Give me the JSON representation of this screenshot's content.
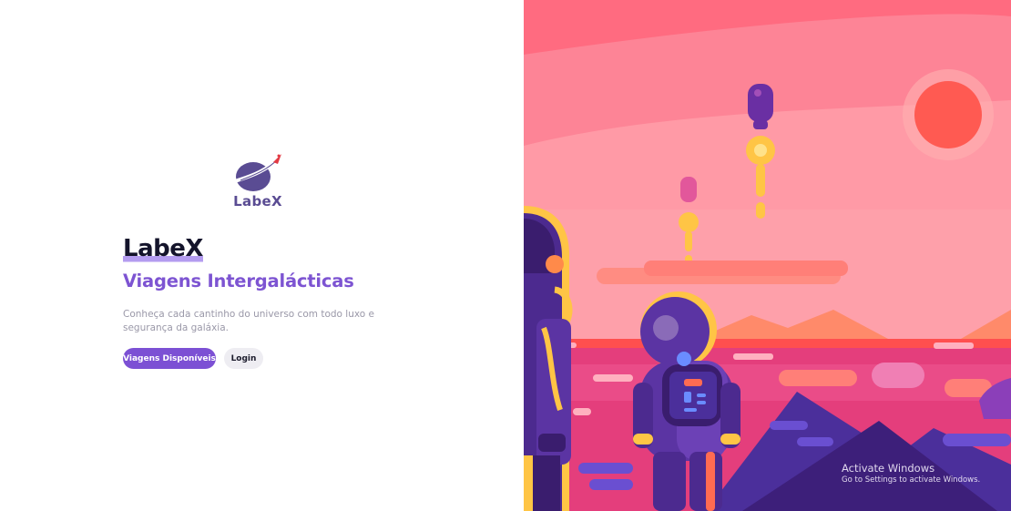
{
  "brand": {
    "logo_text": "LabeX",
    "title": "LabeX",
    "subtitle": "Viagens Intergalácticas",
    "description": "Conheça cada cantinho do universo com todo luxo e segurança da galáxia."
  },
  "actions": {
    "primary_label": "Viagens Disponíveis",
    "secondary_label": "Login"
  },
  "watermark": {
    "title": "Activate Windows",
    "subtitle": "Go to Settings to activate Windows."
  },
  "colors": {
    "accent": "#7c50d4",
    "heading": "#14142b",
    "subtitle": "#7d54d2",
    "illustration_sky": "#fd8496",
    "illustration_sun": "#ff5a52",
    "astronaut_suit": "#4c2a8f"
  },
  "illustration": {
    "icon": "astronauts-watching-rocket-launch-illustration"
  }
}
